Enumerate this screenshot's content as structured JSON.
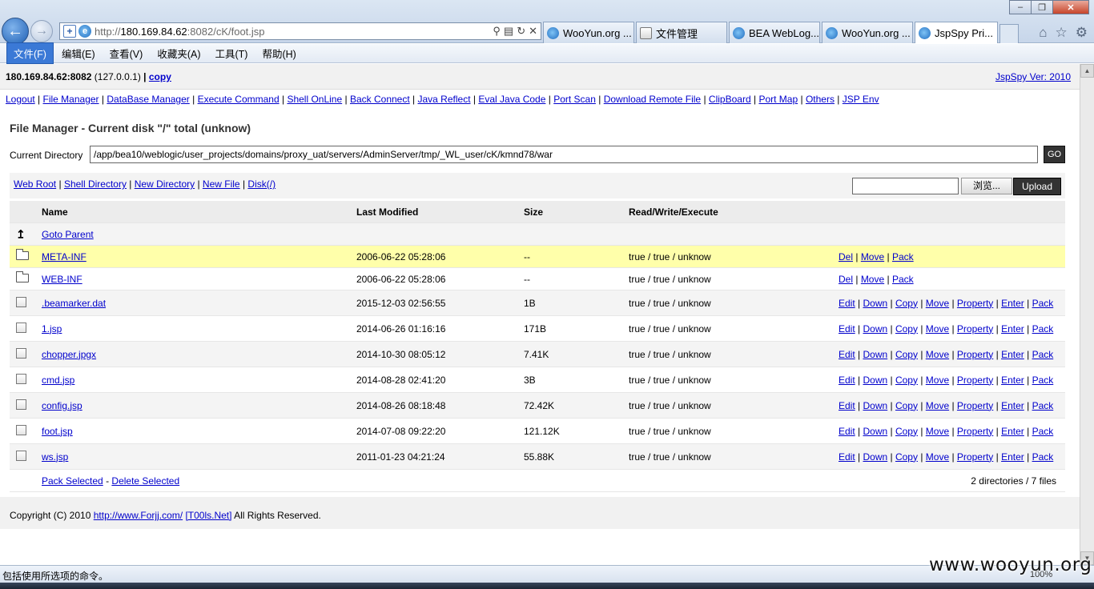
{
  "browser": {
    "url_prefix": "http://",
    "url_host": "180.169.84.62",
    "url_rest": ":8082/cK/foot.jsp",
    "tabs": [
      {
        "label": "WooYun.org ...",
        "icon": "ie-icon"
      },
      {
        "label": "文件管理",
        "icon": "folder-icon"
      },
      {
        "label": "BEA WebLog...",
        "icon": "ie-icon"
      },
      {
        "label": "WooYun.org ...",
        "icon": "ie-icon"
      },
      {
        "label": "JspSpy Pri...",
        "icon": "ie-icon",
        "active": true
      }
    ],
    "menu": [
      "文件(F)",
      "编辑(E)",
      "查看(V)",
      "收藏夹(A)",
      "工具(T)",
      "帮助(H)"
    ],
    "status_text": "包括使用所选项的命令。",
    "zoom": "100%",
    "watermark": "www.wooyun.org"
  },
  "header": {
    "host": "180.169.84.62:8082",
    "local": "(127.0.0.1)",
    "sep": "|",
    "copy_label": "copy",
    "version": "JspSpy Ver: 2010"
  },
  "nav": [
    "Logout",
    "File Manager",
    "DataBase Manager",
    "Execute Command",
    "Shell OnLine",
    "Back Connect",
    "Java Reflect",
    "Eval Java Code",
    "Port Scan",
    "Download Remote File",
    "ClipBoard",
    "Port Map",
    "Others",
    "JSP Env"
  ],
  "file_manager": {
    "title": "File Manager - Current disk \"/\" total (unknow)",
    "current_dir_label": "Current Directory",
    "current_dir": "/app/bea10/weblogic/user_projects/domains/proxy_uat/servers/AdminServer/tmp/_WL_user/cK/kmnd78/war",
    "go_label": "GO",
    "tool_links": [
      "Web Root",
      "Shell Directory",
      "New Directory",
      "New File",
      "Disk(/)"
    ],
    "browse_label": "浏览...",
    "upload_label": "Upload",
    "columns": {
      "name": "Name",
      "modified": "Last Modified",
      "size": "Size",
      "rwe": "Read/Write/Execute"
    },
    "goto_parent": "Goto Parent",
    "dirs": [
      {
        "name": "META-INF",
        "modified": "2006-06-22 05:28:06",
        "size": "--",
        "rwe": "true / true / unknow",
        "actions": [
          "Del",
          "Move",
          "Pack"
        ]
      },
      {
        "name": "WEB-INF",
        "modified": "2006-06-22 05:28:06",
        "size": "--",
        "rwe": "true / true / unknow",
        "actions": [
          "Del",
          "Move",
          "Pack"
        ]
      }
    ],
    "files": [
      {
        "name": ".beamarker.dat",
        "modified": "2015-12-03 02:56:55",
        "size": "1B",
        "rwe": "true / true / unknow"
      },
      {
        "name": "1.jsp",
        "modified": "2014-06-26 01:16:16",
        "size": "171B",
        "rwe": "true / true / unknow"
      },
      {
        "name": "chopper.jpgx",
        "modified": "2014-10-30 08:05:12",
        "size": "7.41K",
        "rwe": "true / true / unknow"
      },
      {
        "name": "cmd.jsp",
        "modified": "2014-08-28 02:41:20",
        "size": "3B",
        "rwe": "true / true / unknow"
      },
      {
        "name": "config.jsp",
        "modified": "2014-08-26 08:18:48",
        "size": "72.42K",
        "rwe": "true / true / unknow"
      },
      {
        "name": "foot.jsp",
        "modified": "2014-07-08 09:22:20",
        "size": "121.12K",
        "rwe": "true / true / unknow"
      },
      {
        "name": "ws.jsp",
        "modified": "2011-01-23 04:21:24",
        "size": "55.88K",
        "rwe": "true / true / unknow"
      }
    ],
    "file_actions": [
      "Edit",
      "Down",
      "Copy",
      "Move",
      "Property",
      "Enter",
      "Pack"
    ],
    "pack_selected": "Pack Selected",
    "dash": "-",
    "delete_selected": "Delete Selected",
    "count": "2 directories / 7 files"
  },
  "footer": {
    "prefix": "Copyright (C) 2010",
    "link1": "http://www.Forjj.com/",
    "link2": "[T00ls.Net]",
    "suffix": "All Rights Reserved."
  }
}
